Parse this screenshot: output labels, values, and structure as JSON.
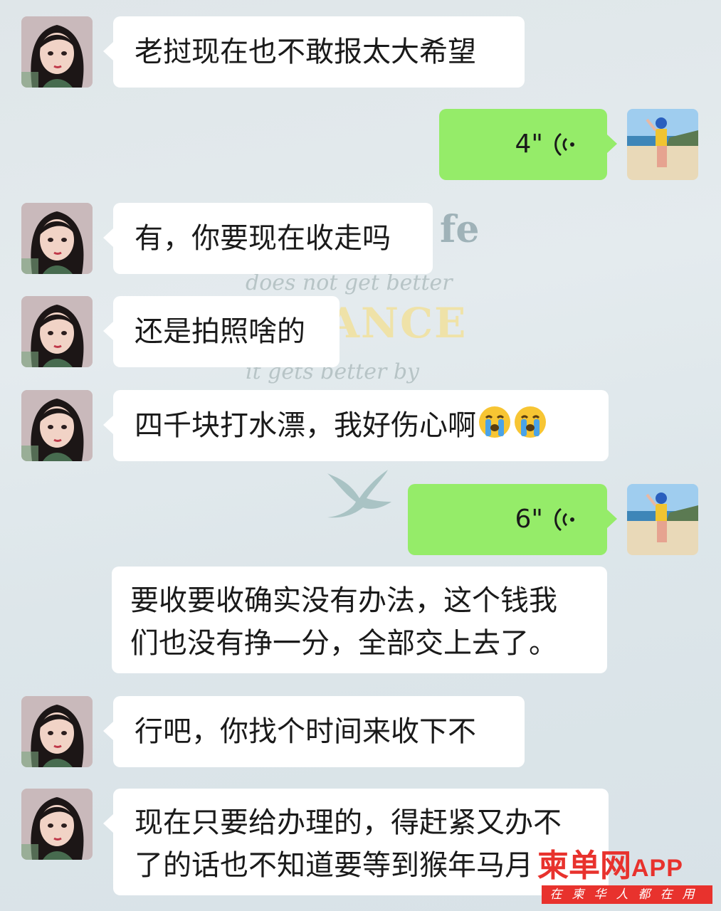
{
  "messages": [
    {
      "side": "left",
      "text": "老挝现在也不敢报太大希望"
    },
    {
      "side": "right",
      "type": "voice",
      "duration": "4\""
    },
    {
      "side": "left",
      "text": "有，你要现在收走吗"
    },
    {
      "side": "left",
      "text": "还是拍照啥的"
    },
    {
      "side": "left",
      "text": "四千块打水漂，我好伤心啊",
      "emoji": [
        "crying-face",
        "crying-face"
      ]
    },
    {
      "side": "right",
      "type": "voice",
      "duration": "6\""
    },
    {
      "side": "left",
      "lines": [
        "要收要收确实没有办法，这个钱我",
        "们也没有挣一分，全部交上去了。"
      ]
    },
    {
      "side": "left",
      "text": "行吧，你找个时间来收下不"
    },
    {
      "side": "left",
      "lines": [
        "现在只要给办理的，得赶紧又办不",
        "了的话也不知道要等到猴年马月"
      ]
    }
  ],
  "wallpaper": {
    "line1": "does not get better",
    "line2": "ANCE",
    "line3": "it gets better by",
    "word": "fe"
  },
  "watermark": {
    "brand": "柬单网",
    "app": "APP",
    "slogan": "在柬华人都在用"
  },
  "colors": {
    "self_bubble": "#95ec69",
    "other_bubble": "#ffffff",
    "brand_red": "#e8322d"
  }
}
